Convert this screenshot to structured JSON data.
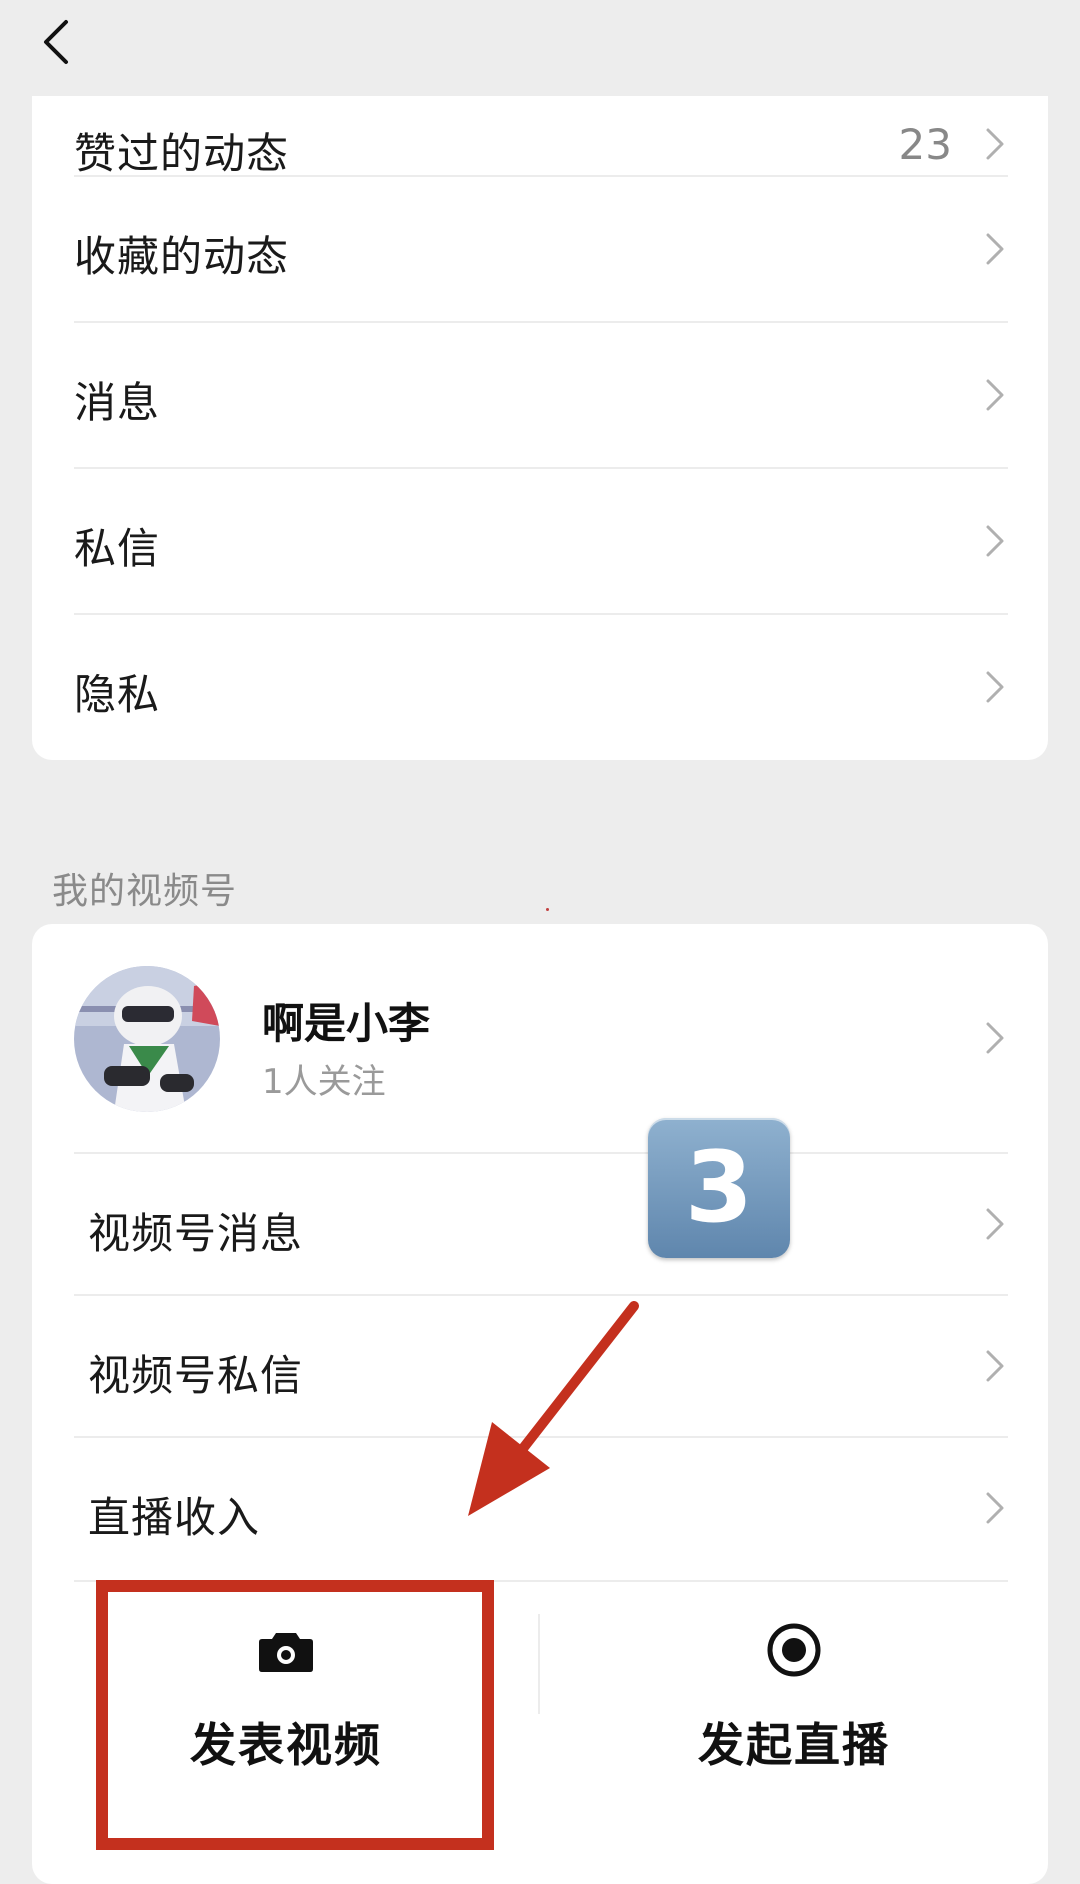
{
  "nav": {
    "back_icon": "chevron-left-icon"
  },
  "moments": {
    "items": [
      {
        "label": "赞过的动态",
        "count": "23"
      },
      {
        "label": "收藏的动态"
      },
      {
        "label": "消息"
      },
      {
        "label": "私信"
      },
      {
        "label": "隐私"
      }
    ]
  },
  "channels": {
    "section_title": "我的视频号",
    "profile": {
      "name": "啊是小李",
      "followers": "1人关注"
    },
    "items": [
      {
        "label": "视频号消息"
      },
      {
        "label": "视频号私信"
      },
      {
        "label": "直播收入"
      }
    ],
    "actions": {
      "post_video": {
        "label": "发表视频",
        "icon": "camera-icon"
      },
      "start_live": {
        "label": "发起直播",
        "icon": "record-circle-icon"
      }
    }
  },
  "annotations": {
    "step_number": "3",
    "highlight_color": "#c4301e",
    "badge_color": "#6f95bb"
  }
}
